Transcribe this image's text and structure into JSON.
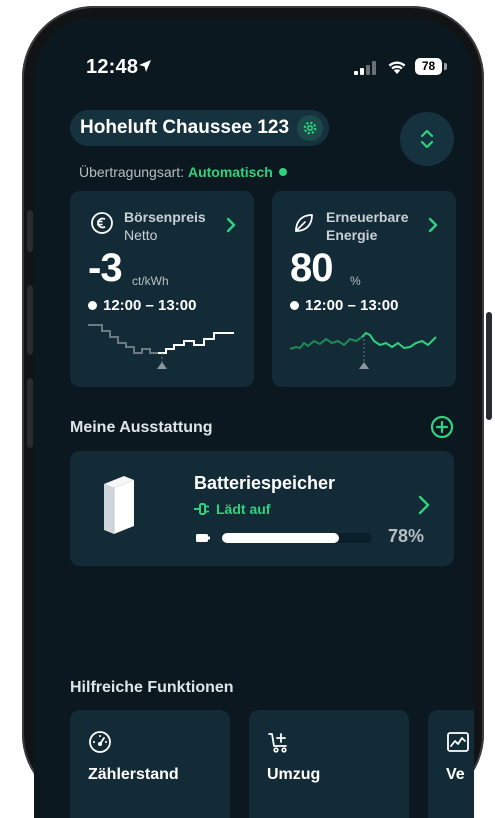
{
  "status_bar": {
    "time": "12:48",
    "battery": "78"
  },
  "header": {
    "address": "Hoheluft Chaussee 123",
    "transfer_label": "Übertragungsart:",
    "transfer_mode": "Automatisch"
  },
  "price_card": {
    "title": "Börsenpreis",
    "subtitle": "Netto",
    "value": "-3",
    "unit": "ct/kWh",
    "time_range": "12:00 – 13:00"
  },
  "renewable_card": {
    "title_line1": "Erneuerbare",
    "title_line2": "Energie",
    "value": "80",
    "unit": "%",
    "time_range": "12:00 – 13:00"
  },
  "equipment": {
    "section_title": "Meine Ausstattung",
    "device": {
      "name": "Batteriespeicher",
      "status": "Lädt auf",
      "charge_percent_label": "78%",
      "charge_fraction": 0.78
    }
  },
  "functions": {
    "section_title": "Hilfreiche Funktionen",
    "items": [
      {
        "label": "Zählerstand",
        "icon": "speedometer-icon"
      },
      {
        "label": "Umzug",
        "icon": "moving-cart-icon"
      },
      {
        "label": "Ve",
        "icon": "chart-icon"
      }
    ]
  },
  "colors": {
    "accent_green": "#2fd27e",
    "background": "#0b1820",
    "card": "#132b37"
  }
}
